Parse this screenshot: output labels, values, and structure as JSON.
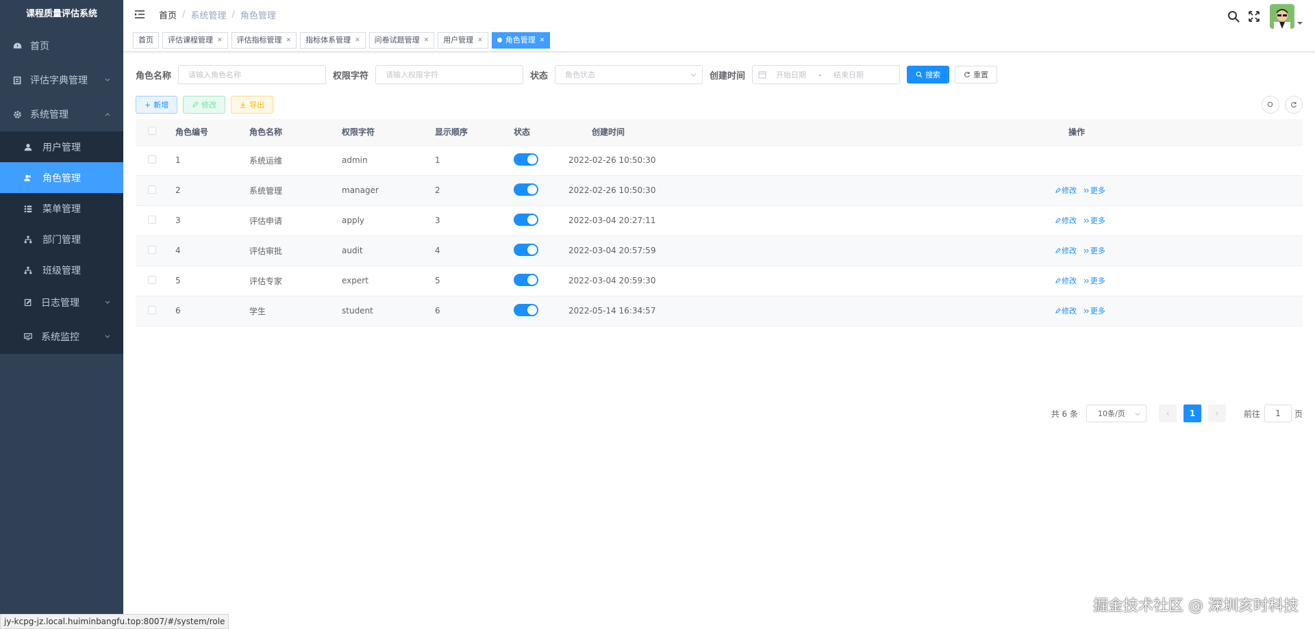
{
  "app": {
    "title": "课程质量评估系统"
  },
  "sidebar": {
    "items": [
      {
        "label": "首页",
        "icon": "dashboard-icon"
      },
      {
        "label": "评估字典管理",
        "icon": "dictionary-icon"
      },
      {
        "label": "系统管理",
        "icon": "gear-icon"
      }
    ],
    "sub_items": [
      {
        "label": "用户管理",
        "icon": "user-icon"
      },
      {
        "label": "角色管理",
        "icon": "peoples-icon"
      },
      {
        "label": "菜单管理",
        "icon": "tree-table-icon"
      },
      {
        "label": "部门管理",
        "icon": "tree-icon"
      },
      {
        "label": "班级管理",
        "icon": "tree-icon"
      }
    ],
    "bottom_items": [
      {
        "label": "日志管理",
        "icon": "log-icon"
      },
      {
        "label": "系统监控",
        "icon": "monitor-icon"
      }
    ]
  },
  "breadcrumb": {
    "home": "首页",
    "level1": "系统管理",
    "level2": "角色管理"
  },
  "tags": [
    {
      "label": "首页"
    },
    {
      "label": "评估课程管理"
    },
    {
      "label": "评估指标管理"
    },
    {
      "label": "指标体系管理"
    },
    {
      "label": "问卷试题管理"
    },
    {
      "label": "用户管理"
    },
    {
      "label": "角色管理"
    }
  ],
  "search": {
    "role_name_label": "角色名称",
    "role_name_placeholder": "请输入角色名称",
    "role_key_label": "权限字符",
    "role_key_placeholder": "请输入权限字符",
    "status_label": "状态",
    "status_placeholder": "角色状态",
    "create_time_label": "创建时间",
    "start_placeholder": "开始日期",
    "range_sep": "-",
    "end_placeholder": "结束日期",
    "search_btn": "搜索",
    "reset_btn": "重置"
  },
  "toolbar": {
    "add": "新增",
    "edit": "修改",
    "export": "导出"
  },
  "table": {
    "headers": [
      "角色编号",
      "角色名称",
      "权限字符",
      "显示顺序",
      "状态",
      "创建时间",
      "操作"
    ],
    "rows": [
      {
        "id": "1",
        "name": "系统运维",
        "key": "admin",
        "sort": "1",
        "status": true,
        "time": "2022-02-26 10:50:30",
        "ops": false
      },
      {
        "id": "2",
        "name": "系统管理",
        "key": "manager",
        "sort": "2",
        "status": true,
        "time": "2022-02-26 10:50:30",
        "ops": true
      },
      {
        "id": "3",
        "name": "评估申请",
        "key": "apply",
        "sort": "3",
        "status": true,
        "time": "2022-03-04 20:27:11",
        "ops": true
      },
      {
        "id": "4",
        "name": "评估审批",
        "key": "audit",
        "sort": "4",
        "status": true,
        "time": "2022-03-04 20:57:59",
        "ops": true
      },
      {
        "id": "5",
        "name": "评估专家",
        "key": "expert",
        "sort": "5",
        "status": true,
        "time": "2022-03-04 20:59:30",
        "ops": true
      },
      {
        "id": "6",
        "name": "学生",
        "key": "student",
        "sort": "6",
        "status": true,
        "time": "2022-05-14 16:34:57",
        "ops": true
      }
    ],
    "op_edit": "修改",
    "op_more": "更多"
  },
  "pagination": {
    "total_text": "共 6 条",
    "page_size": "10条/页",
    "current": "1",
    "goto_label": "前往",
    "goto_value": "1",
    "page_suffix": "页"
  },
  "status_url": "jy-kcpg-jz.local.huiminbangfu.top:8007/#/system/role",
  "watermark": "掘金技术社区 @ 深圳亥时科技",
  "colors": {
    "sidebar_bg": "#304156",
    "submenu_bg": "#1f2d3d",
    "primary": "#1890ff",
    "active_menu": "#409eff"
  }
}
